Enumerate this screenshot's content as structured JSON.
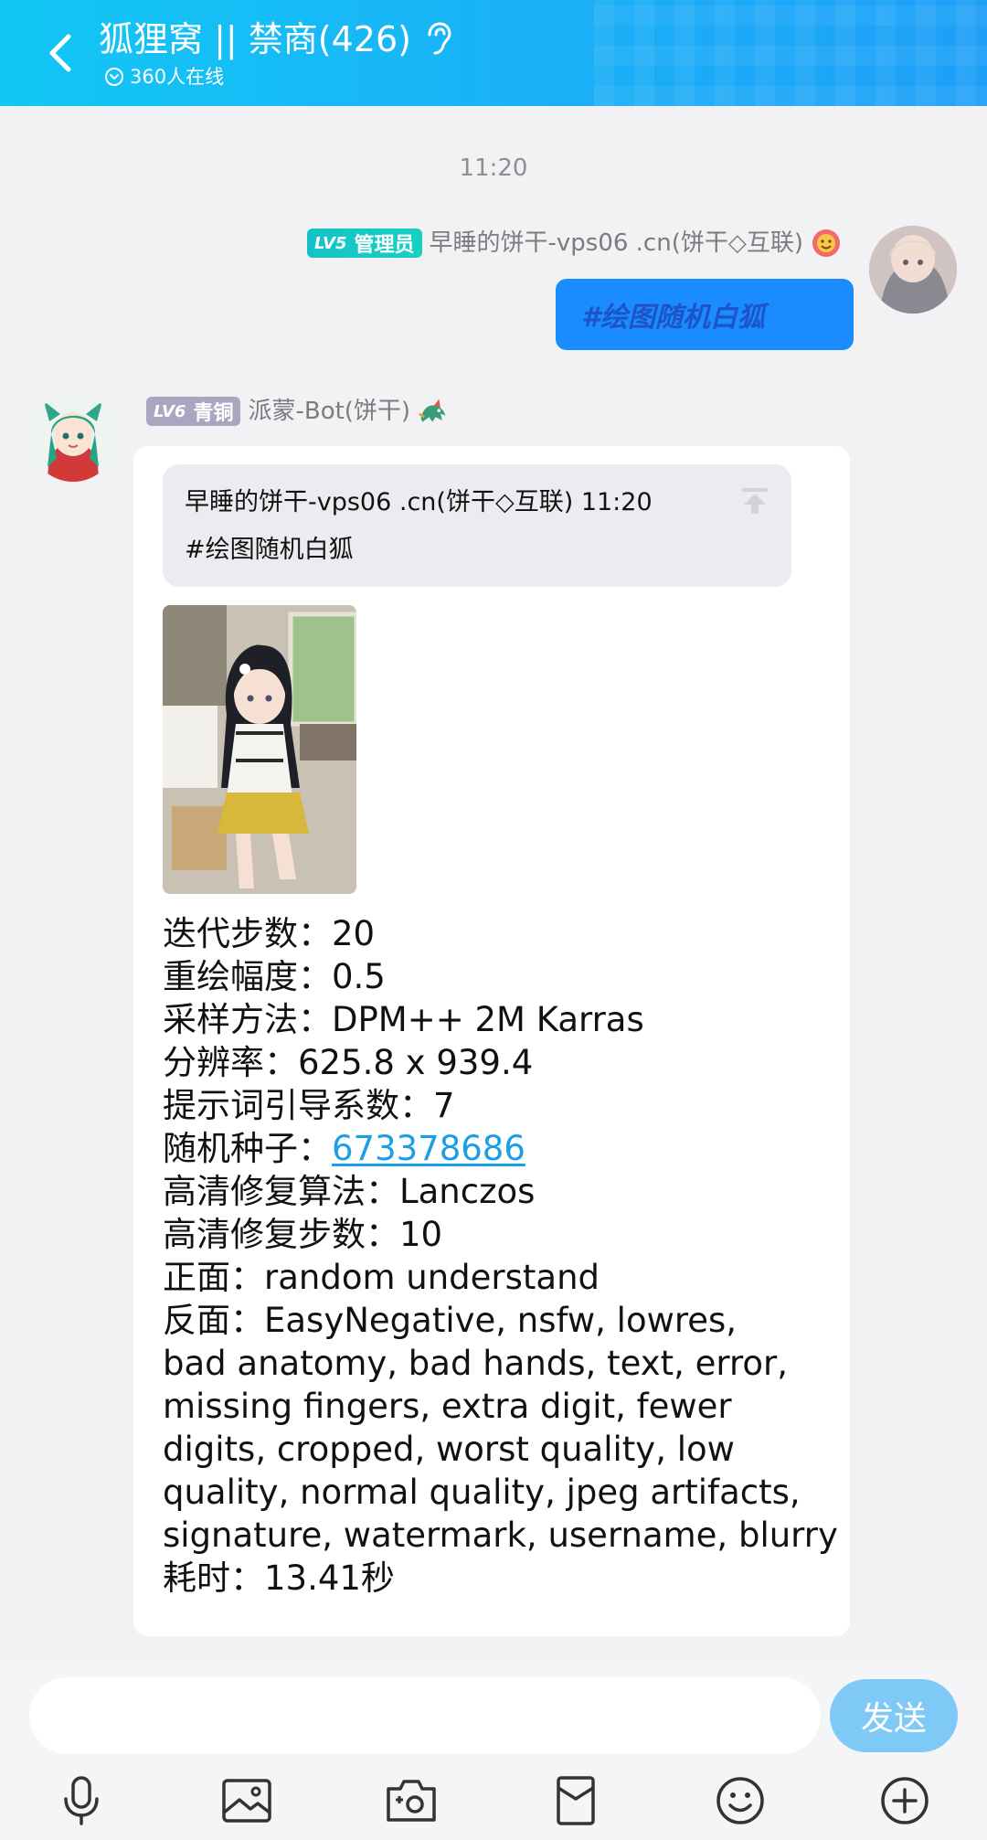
{
  "header": {
    "title": "狐狸窝 || 禁商(426)",
    "online": "360人在线",
    "colors": {
      "start": "#12c7f4",
      "end": "#1e9ff8"
    }
  },
  "chat": {
    "timestamp": "11:20",
    "messages": [
      {
        "side": "right",
        "badge_level": "LV5",
        "badge_role": "管理员",
        "sender": "早睡的饼干-vps06 .cn(饼干◇互联)",
        "text": "#绘图随机白狐"
      },
      {
        "side": "left",
        "badge_level": "LV6",
        "badge_role": "青铜",
        "sender": "派蒙-Bot(饼干)",
        "quote": {
          "header": "早睡的饼干-vps06 .cn(饼干◇互联) 11:20",
          "body": "#绘图随机白狐"
        },
        "params": {
          "steps": "迭代步数：20",
          "denoise": "重绘幅度：0.5",
          "sampler": "采样方法：DPM++ 2M Karras",
          "resolution": "分辨率：625.8 x 939.4",
          "cfg": "提示词引导系数：7",
          "seed_label": "随机种子：",
          "seed_value": "673378686",
          "hires_upscaler": "高清修复算法：Lanczos",
          "hires_steps": "高清修复步数：10",
          "positive": "正面：random understand",
          "negative_1": "反面：EasyNegative, nsfw, lowres,",
          "negative_2": "bad anatomy, bad hands, text, error,",
          "negative_3": "missing fingers, extra digit, fewer",
          "negative_4": "digits, cropped, worst quality, low",
          "negative_5": "quality, normal quality, jpeg artifacts,",
          "negative_6": "signature, watermark, username, blurry",
          "elapsed": "耗时：13.41秒"
        }
      }
    ]
  },
  "input": {
    "placeholder": "",
    "send_label": "发送"
  },
  "toolbar": {
    "icons": [
      "microphone-icon",
      "image-icon",
      "camera-icon",
      "red-packet-icon",
      "emoji-icon",
      "plus-icon"
    ]
  }
}
